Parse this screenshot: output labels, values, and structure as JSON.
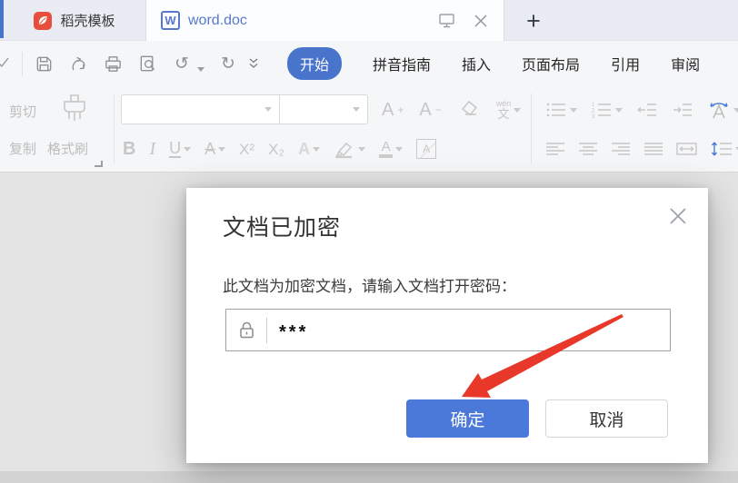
{
  "tabbar": {
    "docer_label": "稻壳模板",
    "writer_icon_letter": "W",
    "doc_label": "word.doc",
    "new_tab_label": "+"
  },
  "ribbon": {
    "tabs": [
      {
        "label": "开始",
        "active": true
      },
      {
        "label": "拼音指南",
        "active": false
      },
      {
        "label": "插入",
        "active": false
      },
      {
        "label": "页面布局",
        "active": false
      },
      {
        "label": "引用",
        "active": false
      },
      {
        "label": "审阅",
        "active": false
      }
    ],
    "undo_glyph": "↺",
    "redo_glyph": "↻"
  },
  "toolbar": {
    "cut_label": "剪切",
    "copy_label": "复制",
    "format_painter_label": "格式刷",
    "bold": "B",
    "italic": "I",
    "underline": "U",
    "strike_letter": "A",
    "superscript": "X²",
    "subscript": "X₂",
    "effect_letter": "A",
    "color_letter": "A",
    "shading_letter": "A",
    "grow_letter": "A",
    "grow_sign": "+",
    "shrink_letter": "A",
    "shrink_sign": "−",
    "wen_pinyin": "wén",
    "wen_char": "文"
  },
  "dialog": {
    "title": "文档已加密",
    "message": "此文档为加密文档，请输入文档打开密码：",
    "password_value": "***",
    "ok_label": "确定",
    "cancel_label": "取消"
  },
  "colors": {
    "accent_blue": "#4874cb",
    "ok_button_blue": "#4b79da",
    "doc_tab_text_blue": "#5878cb",
    "docer_red": "#e84e3d",
    "arrow_red": "#e8382a",
    "canvas_gray": "#e4e4e4"
  }
}
